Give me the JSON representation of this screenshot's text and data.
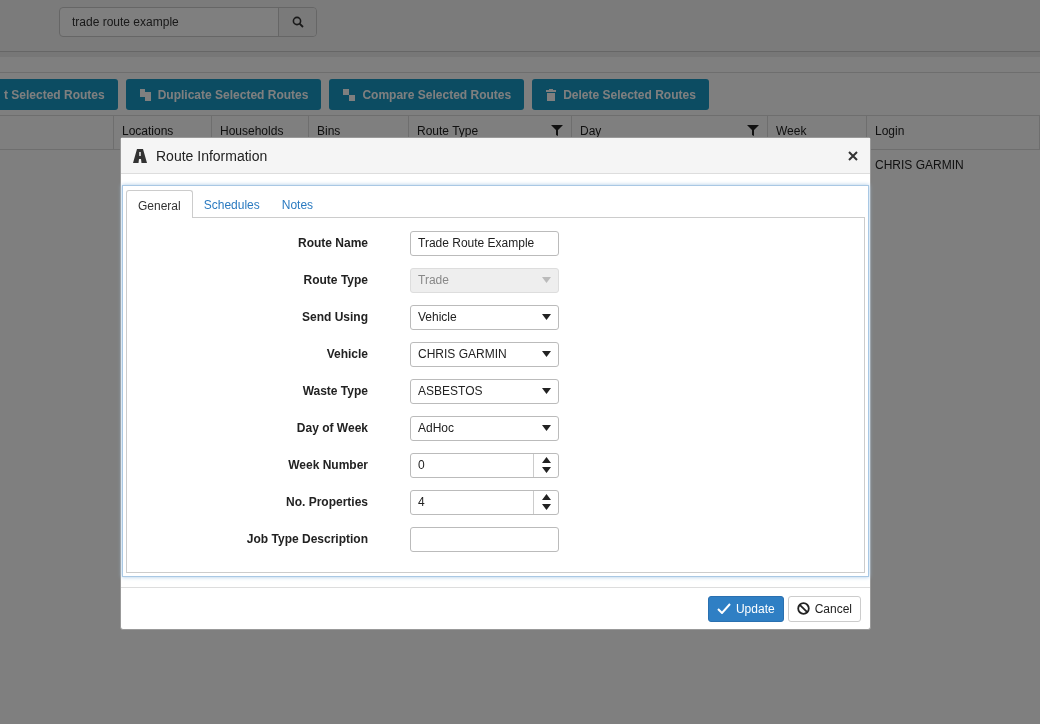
{
  "search": {
    "value": "trade route example"
  },
  "toolbar": [
    {
      "kind": "plain",
      "label": "t Selected Routes"
    },
    {
      "kind": "duplicate",
      "label": "Duplicate Selected Routes"
    },
    {
      "kind": "compare",
      "label": "Compare Selected Routes"
    },
    {
      "kind": "delete",
      "label": "Delete Selected Routes"
    }
  ],
  "table": {
    "columns": [
      {
        "filter": false
      },
      {
        "label": "Locations",
        "filter": false
      },
      {
        "label": "Households",
        "filter": false
      },
      {
        "label": "Bins",
        "filter": false
      },
      {
        "label": "Route Type",
        "filter": true
      },
      {
        "label": "Day",
        "filter": true
      },
      {
        "label": "Week",
        "filter": false
      },
      {
        "label": "Login",
        "filter": false
      }
    ],
    "rows": [
      {
        "login": "CHRIS GARMIN"
      }
    ]
  },
  "dialog": {
    "title": "Route Information",
    "tabs": [
      {
        "label": "General",
        "selected": true
      },
      {
        "label": "Schedules",
        "selected": false
      },
      {
        "label": "Notes",
        "selected": false
      }
    ],
    "fields": [
      {
        "label": "Route Name",
        "kind": "text",
        "value": "Trade Route Example",
        "disabled": false
      },
      {
        "label": "Route Type",
        "kind": "select",
        "value": "Trade",
        "disabled": true
      },
      {
        "label": "Send Using",
        "kind": "select",
        "value": "Vehicle",
        "disabled": false
      },
      {
        "label": "Vehicle",
        "kind": "select",
        "value": "CHRIS GARMIN",
        "disabled": false
      },
      {
        "label": "Waste Type",
        "kind": "select",
        "value": "ASBESTOS",
        "disabled": false
      },
      {
        "label": "Day of Week",
        "kind": "select",
        "value": "AdHoc",
        "disabled": false
      },
      {
        "label": "Week Number",
        "kind": "number",
        "value": "0",
        "disabled": false
      },
      {
        "label": "No. Properties",
        "kind": "number",
        "value": "4",
        "disabled": false
      },
      {
        "label": "Job Type Description",
        "kind": "text",
        "disabled": false
      }
    ],
    "buttons": [
      {
        "kind": "primary",
        "label": "Update"
      },
      {
        "kind": "cancel",
        "label": "Cancel"
      }
    ]
  }
}
